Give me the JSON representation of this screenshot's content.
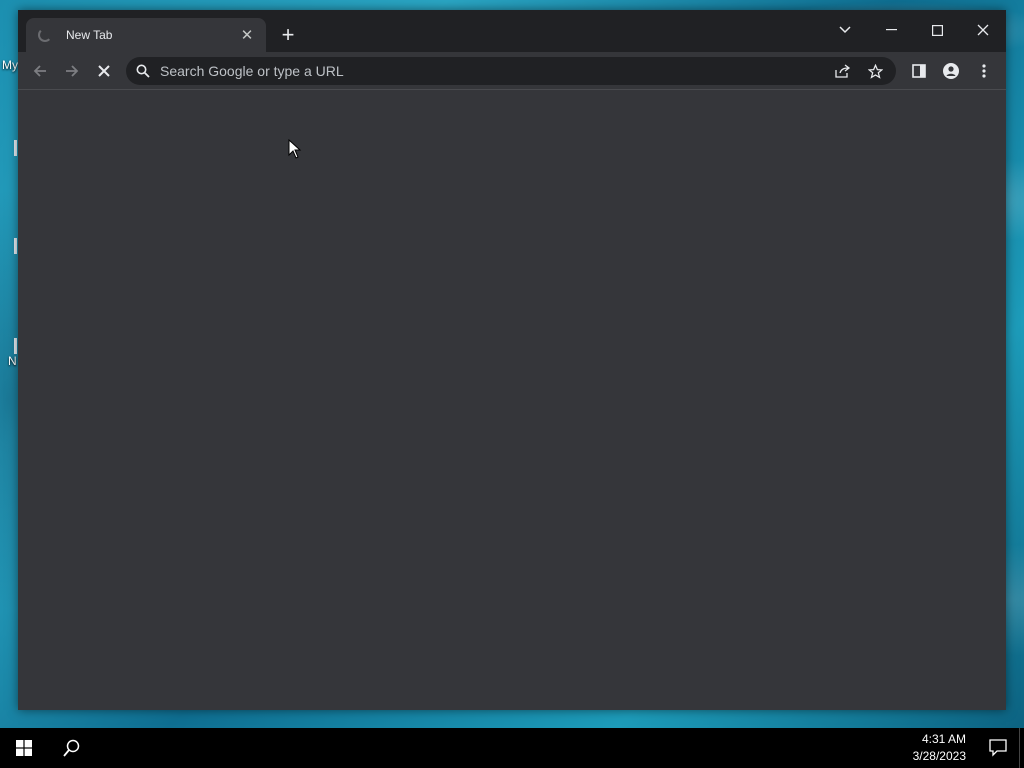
{
  "desktop": {
    "icons": [
      {
        "label": "My"
      },
      {
        "label": "N"
      }
    ]
  },
  "browser": {
    "tab": {
      "title": "New Tab"
    },
    "omnibox": {
      "placeholder": "Search Google or type a URL",
      "value": ""
    }
  },
  "taskbar": {
    "time": "4:31 AM",
    "date": "3/28/2023"
  },
  "colors": {
    "frame": "#202124",
    "toolbar": "#35363a",
    "omnibox": "#202124",
    "text": "#e8eaed"
  }
}
